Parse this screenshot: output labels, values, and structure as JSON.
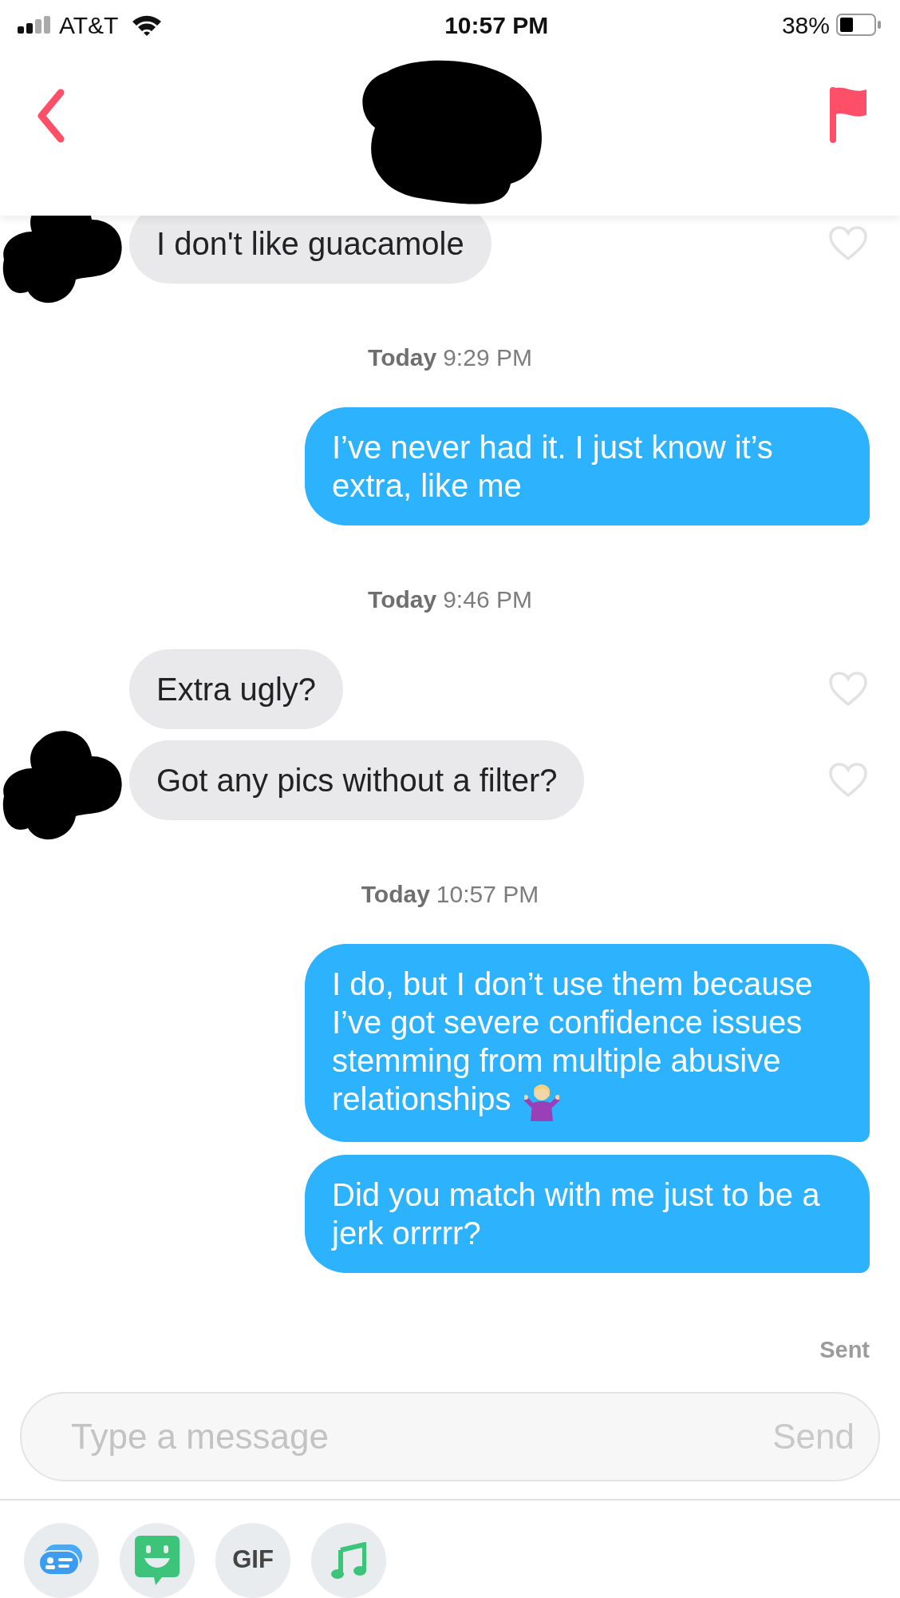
{
  "status_bar": {
    "carrier": "AT&T",
    "time": "10:57 PM",
    "battery": "38%"
  },
  "messages": [
    {
      "kind": "received",
      "text": "I don't like guacamole",
      "liked": false,
      "avatar": true
    },
    {
      "kind": "timestamp",
      "day": "Today",
      "time": "9:29 PM"
    },
    {
      "kind": "sent",
      "text": "I’ve never had it. I just know it’s extra, like me"
    },
    {
      "kind": "timestamp",
      "day": "Today",
      "time": "9:46 PM"
    },
    {
      "kind": "received",
      "text": "Extra ugly?",
      "liked": false,
      "avatar": false
    },
    {
      "kind": "received",
      "text": "Got any pics without a filter?",
      "liked": false,
      "avatar": true
    },
    {
      "kind": "timestamp",
      "day": "Today",
      "time": "10:57 PM"
    },
    {
      "kind": "sent",
      "text": "I do, but I don’t use them because I’ve got severe confidence issues stemming from multiple abusive relationships",
      "shrug_emoji": true
    },
    {
      "kind": "sent",
      "text": "Did you match with me just to be a jerk orrrrr?"
    }
  ],
  "delivery_status": "Sent",
  "composer": {
    "placeholder": "Type a message",
    "send_label": "Send"
  },
  "toolbar": [
    {
      "kind": "card"
    },
    {
      "kind": "sticker"
    },
    {
      "kind": "gif",
      "label": "GIF"
    },
    {
      "kind": "music"
    }
  ]
}
